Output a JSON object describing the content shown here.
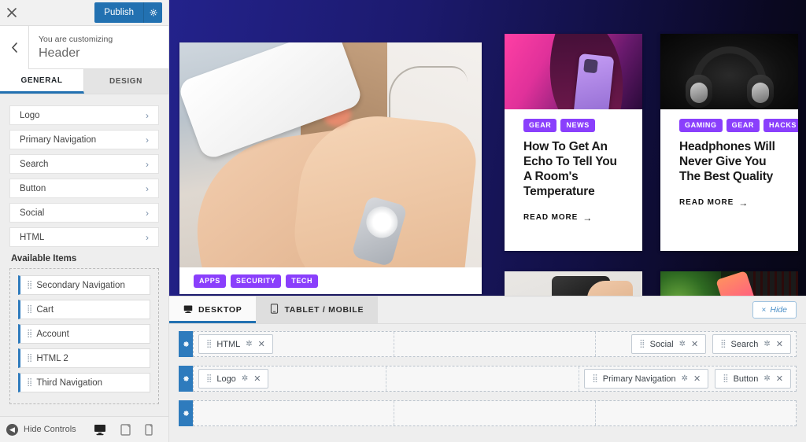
{
  "sidebar": {
    "close_icon": "close-icon",
    "publish_label": "Publish",
    "publish_gear_icon": "gear-icon",
    "back_icon": "chevron-left-icon",
    "kicker": "You are customizing",
    "title": "Header",
    "tabs": [
      {
        "label": "GENERAL",
        "active": true
      },
      {
        "label": "DESIGN",
        "active": false
      }
    ],
    "panels": [
      {
        "label": "Logo"
      },
      {
        "label": "Primary Navigation"
      },
      {
        "label": "Search"
      },
      {
        "label": "Button"
      },
      {
        "label": "Social"
      },
      {
        "label": "HTML"
      }
    ],
    "available_title": "Available Items",
    "available_items": [
      {
        "label": "Secondary Navigation"
      },
      {
        "label": "Cart"
      },
      {
        "label": "Account"
      },
      {
        "label": "HTML 2"
      },
      {
        "label": "Third Navigation"
      }
    ],
    "footer": {
      "hide_controls_label": "Hide Controls",
      "devices": [
        {
          "name": "desktop-view",
          "active": true
        },
        {
          "name": "tablet-view",
          "active": false
        },
        {
          "name": "mobile-view",
          "active": false
        }
      ]
    }
  },
  "preview": {
    "hero": {
      "tags": [
        "APPS",
        "SECURITY",
        "TECH"
      ]
    },
    "cards": [
      {
        "tags": [
          "GEAR",
          "NEWS"
        ],
        "title": "How To Get An Echo To Tell You A Room's Temperature",
        "read_more": "READ MORE",
        "arrow": "→"
      },
      {
        "tags": [
          "GAMING",
          "GEAR",
          "HACKS"
        ],
        "title": "Headphones Will Never Give You The Best Quality",
        "read_more": "READ MORE",
        "arrow": "→"
      }
    ]
  },
  "builder": {
    "tabs": [
      {
        "label": "DESKTOP",
        "icon": "desktop-icon",
        "active": true
      },
      {
        "label": "TABLET / MOBILE",
        "icon": "mobile-icon",
        "active": false
      }
    ],
    "hide_label": "Hide",
    "hide_x": "×",
    "rows": [
      {
        "name": "top-row",
        "left": [
          {
            "label": "HTML"
          }
        ],
        "center": [],
        "right": [
          {
            "label": "Social"
          },
          {
            "label": "Search"
          }
        ]
      },
      {
        "name": "main-row",
        "left": [
          {
            "label": "Logo"
          }
        ],
        "center": [],
        "right": [
          {
            "label": "Primary Navigation"
          },
          {
            "label": "Button"
          }
        ]
      },
      {
        "name": "bottom-row",
        "left": [],
        "center": [],
        "right": []
      }
    ]
  },
  "colors": {
    "accent_blue": "#2271b1",
    "tag_purple": "#8a3ffc",
    "builder_blue": "#2e7bbd",
    "preview_bg": "#1f2180"
  }
}
